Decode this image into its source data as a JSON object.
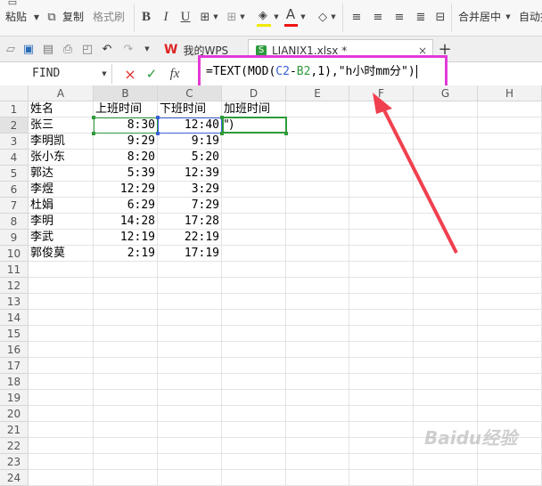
{
  "ribbon": {
    "paste_label": "粘贴",
    "copy_label": "复制",
    "format_painter_label": "格式刷",
    "bold": "B",
    "italic": "I",
    "underline": "U",
    "font_color_glyph": "A",
    "merge_center_label": "合并居中",
    "auto_wrap_label": "自动换"
  },
  "tabs": {
    "wps_label": "我的WPS",
    "file_label": "LIANIX1.xlsx *",
    "new_tab": "+"
  },
  "formula_bar": {
    "name_box": "FIND",
    "cancel_glyph": "×",
    "confirm_glyph": "✓",
    "fx_label": "fx",
    "formula_prefix": "=TEXT(MOD(",
    "ref_c2": "C2",
    "formula_minus": "-",
    "ref_b2": "B2",
    "formula_suffix": ",1),\"h小时mm分\")"
  },
  "sheet": {
    "columns": [
      "A",
      "B",
      "C",
      "D",
      "E",
      "F",
      "G",
      "H"
    ],
    "row_numbers": [
      "1",
      "2",
      "3",
      "4",
      "5",
      "6",
      "7",
      "8",
      "9",
      "10",
      "11",
      "12",
      "13",
      "14",
      "15",
      "16",
      "17",
      "18",
      "19",
      "20",
      "21",
      "22",
      "23",
      "24"
    ],
    "headers": {
      "name": "姓名",
      "start": "上班时间",
      "end": "下班时间",
      "overtime": "加班时间"
    },
    "rows": [
      {
        "name": "张三",
        "start": "8:30",
        "end": "12:40"
      },
      {
        "name": "李明凯",
        "start": "9:29",
        "end": "9:19"
      },
      {
        "name": "张小东",
        "start": "8:20",
        "end": "5:20"
      },
      {
        "name": "郭达",
        "start": "5:39",
        "end": "12:39"
      },
      {
        "name": "李煜",
        "start": "12:29",
        "end": "3:29"
      },
      {
        "name": "杜娟",
        "start": "6:29",
        "end": "7:29"
      },
      {
        "name": "李明",
        "start": "14:28",
        "end": "17:28"
      },
      {
        "name": "李武",
        "start": "12:19",
        "end": "22:19"
      },
      {
        "name": "郭俊莫",
        "start": "2:19",
        "end": "17:19"
      }
    ],
    "editing_cell_text": "\")"
  },
  "watermark": "Baidu经验",
  "colors": {
    "annotation_box": "#e23ad8",
    "arrow": "#f0404f",
    "ref_c2": "#3a5fd6",
    "ref_b2": "#2e9a3a",
    "active_cell": "#2e9a3a"
  }
}
